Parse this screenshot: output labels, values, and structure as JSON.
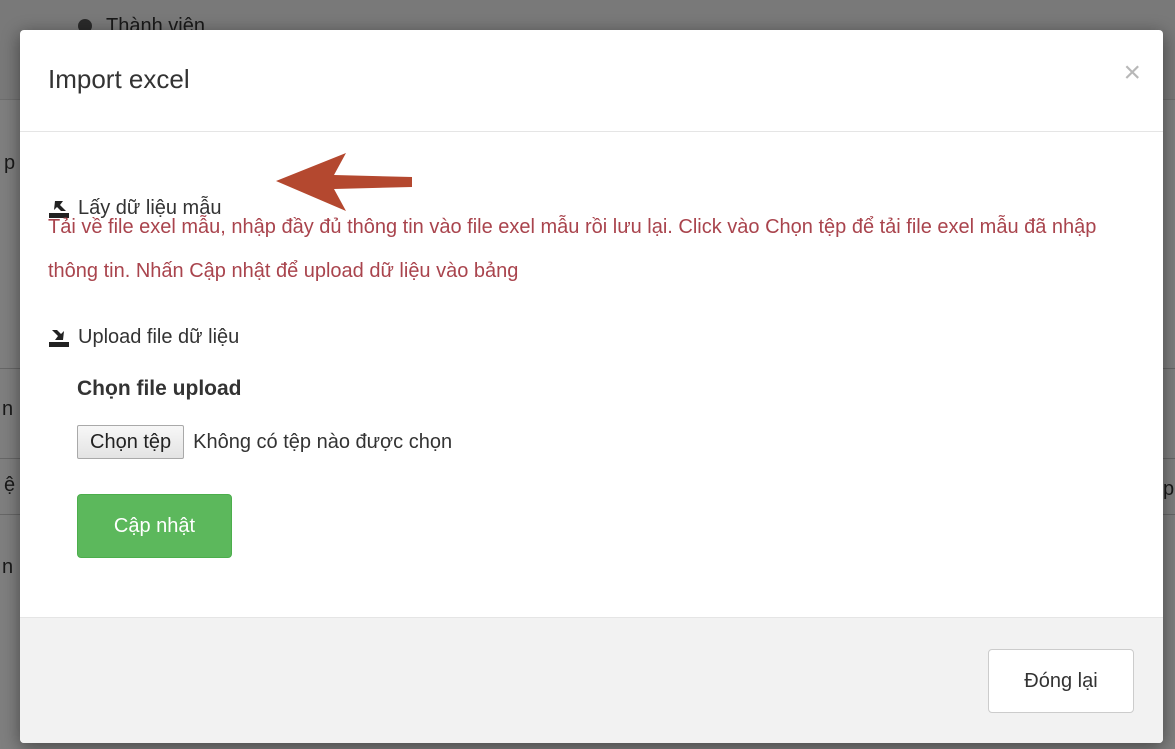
{
  "background": {
    "member_label": "Thành viên",
    "fragments": [
      "p",
      "n",
      "ệ",
      "n",
      "p"
    ]
  },
  "modal": {
    "title": "Import excel",
    "close_glyph": "×",
    "download_link": "Lấy dữ liệu mẫu",
    "download_icon": "download-icon",
    "hint": "Tải về file exel mẫu, nhập đầy đủ thông tin vào file exel mẫu rồi lưu lại. Click vào Chọn tệp để tải file exel mẫu đã nhập thông tin. Nhấn Cập nhật để upload dữ liệu vào bảng",
    "upload_link": "Upload file dữ liệu",
    "upload_icon": "upload-icon",
    "file_label": "Chọn file upload",
    "file_button": "Chọn tệp",
    "file_status": "Không có tệp nào được chọn",
    "update_button": "Cập nhật",
    "close_button": "Đóng lại"
  },
  "colors": {
    "hint_text": "#a9444d",
    "arrow": "#b4482f",
    "primary_green": "#5cb85c",
    "footer_bg": "#f2f2f2"
  }
}
